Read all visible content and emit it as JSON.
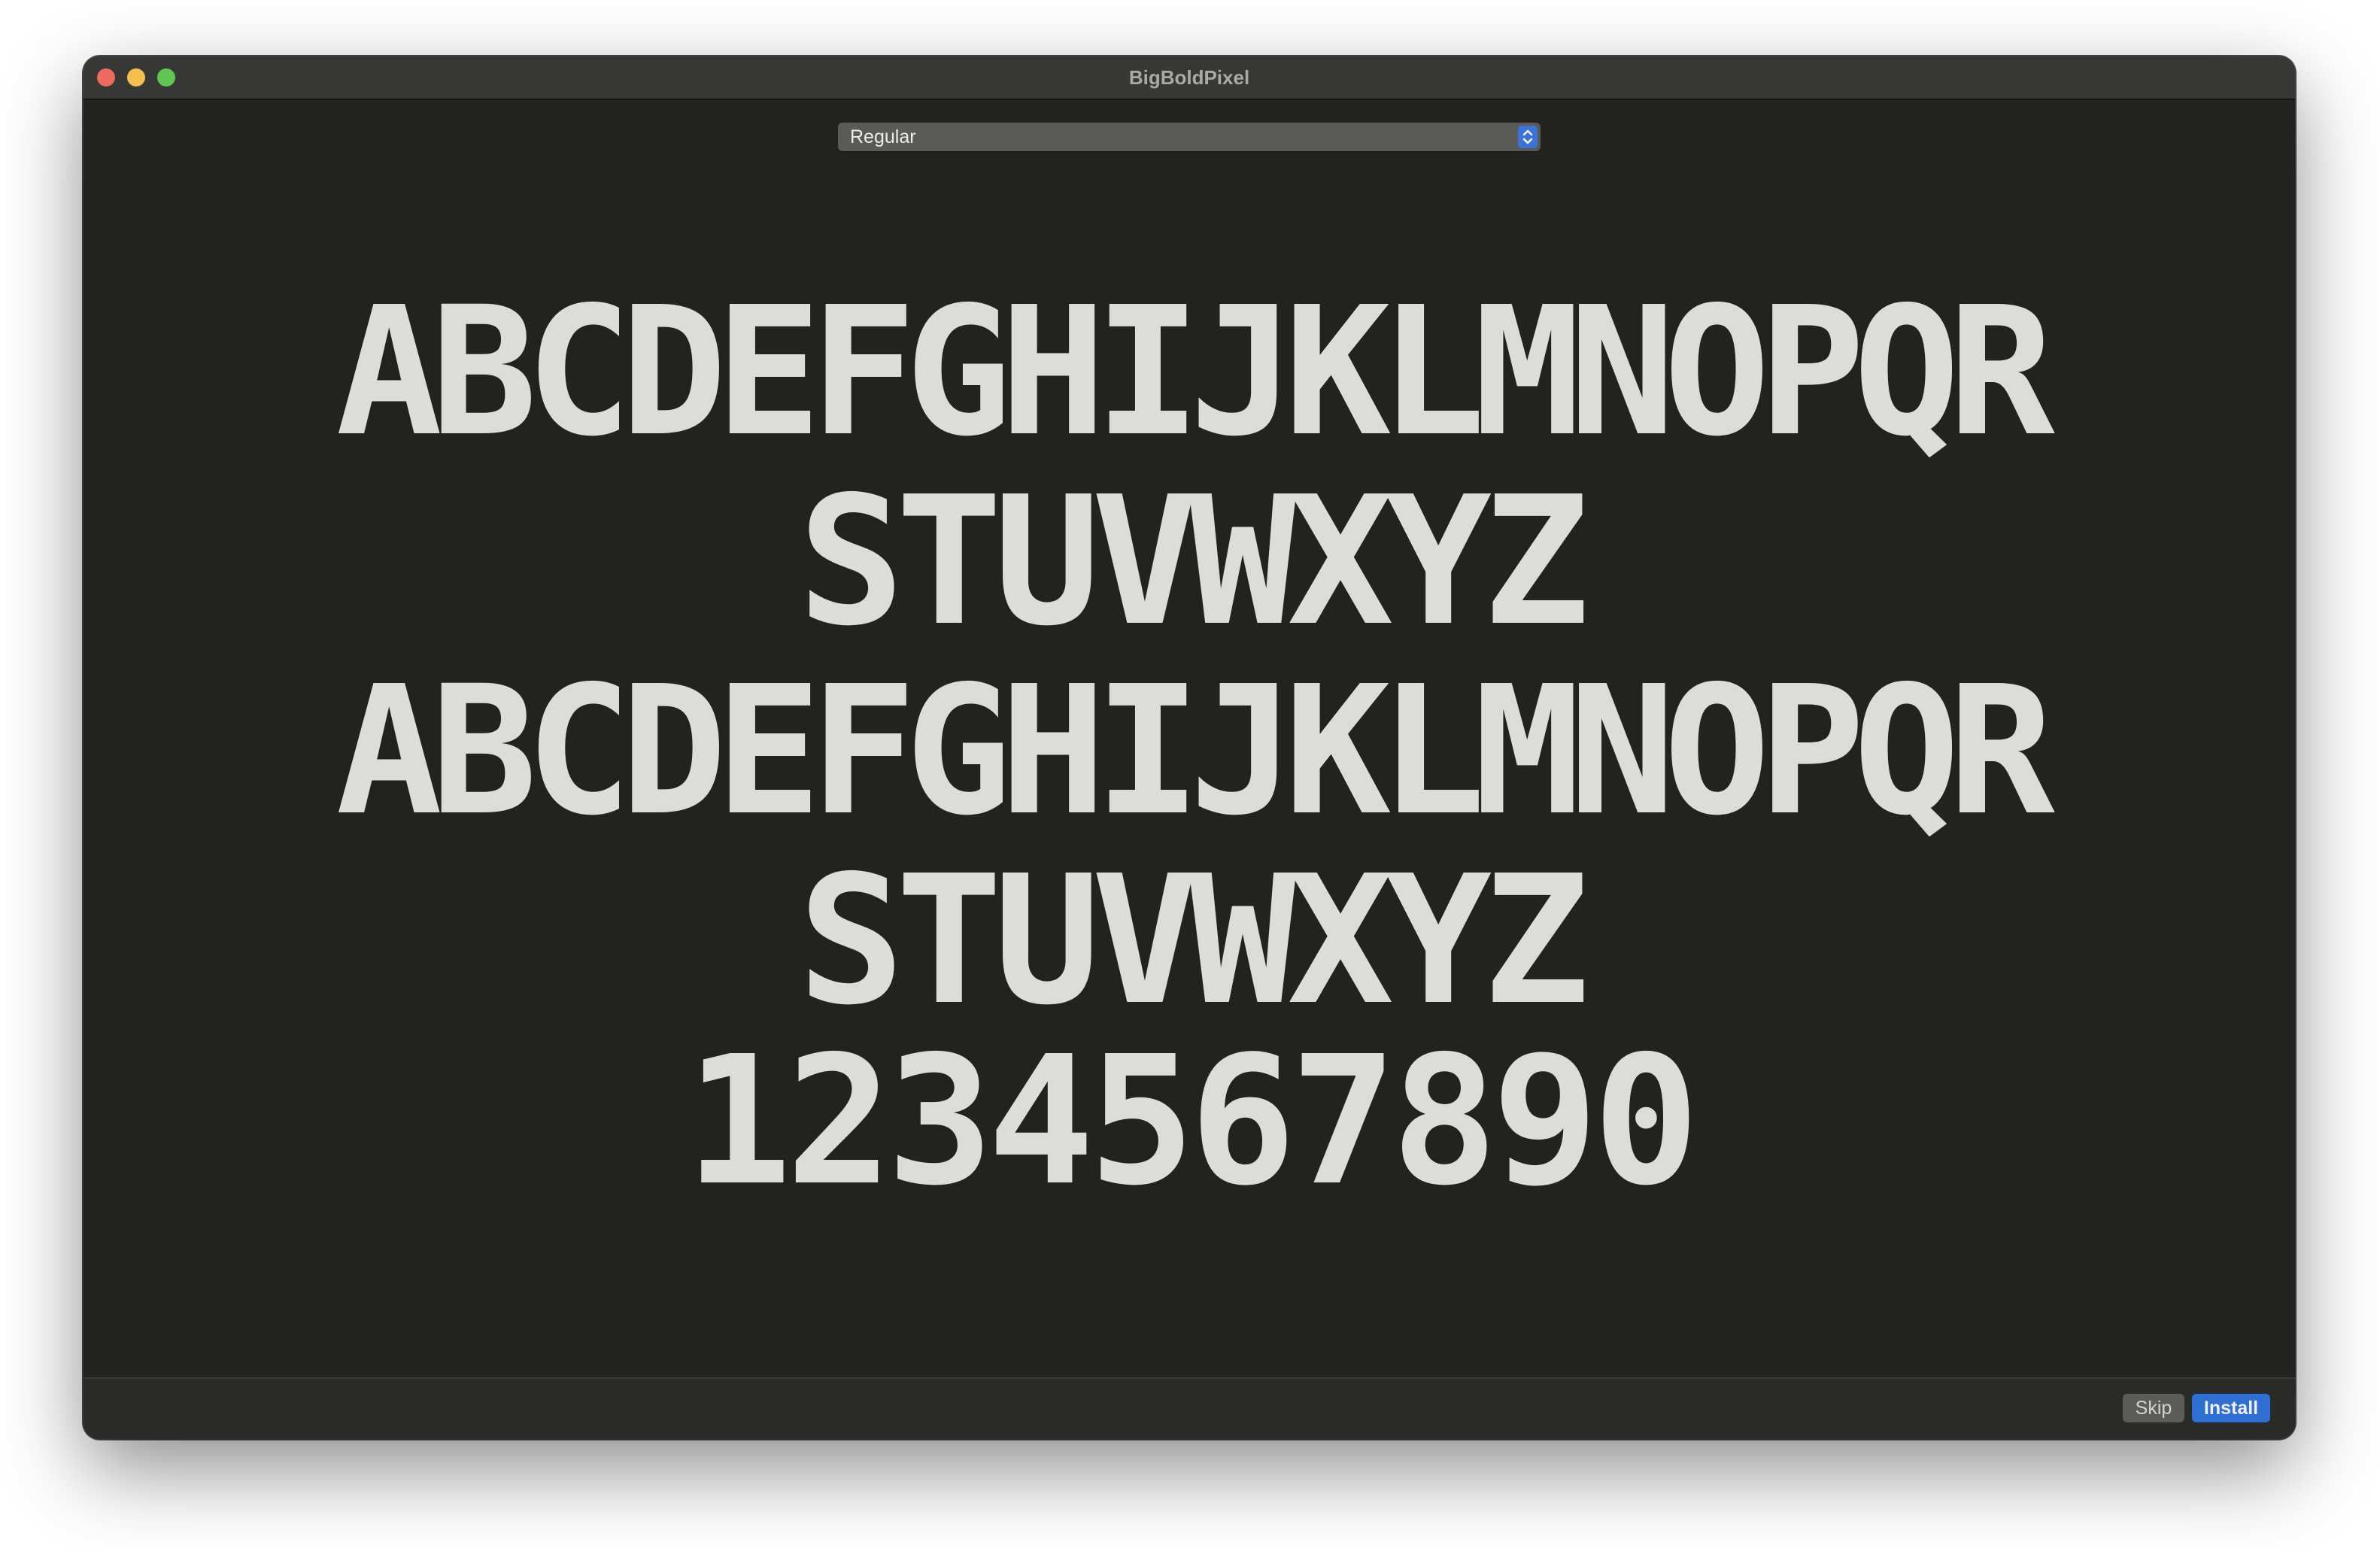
{
  "window": {
    "title": "BigBoldPixel"
  },
  "style_select": {
    "selected": "Regular",
    "icon": "chevron-up-down-icon"
  },
  "preview": {
    "lines": [
      "ABCDEFGHIJKLMNOPQR",
      "STUVWXYZ",
      "ABCDEFGHIJKLMNOPQR",
      "STUVWXYZ",
      "1234567890"
    ]
  },
  "footer": {
    "skip_label": "Skip",
    "install_label": "Install"
  },
  "colors": {
    "background": "#222220",
    "glyph": "#dcdcda",
    "accent": "#2f6fd4"
  }
}
